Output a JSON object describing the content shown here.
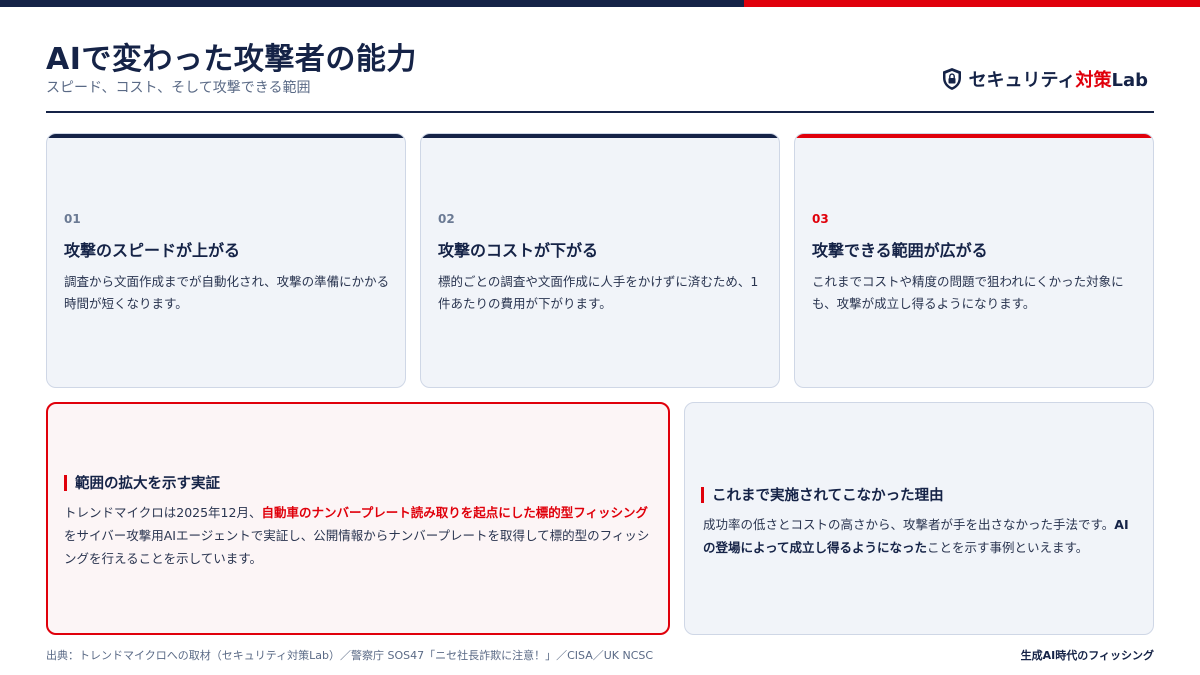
{
  "header": {
    "title": "AIで変わった攻撃者の能力",
    "subtitle": "スピード、コスト、そして攻撃できる範囲"
  },
  "brand": {
    "name_main": "セキュリティ",
    "name_accent": "対策",
    "name_suffix": "Lab",
    "icon": "shield-lock-icon"
  },
  "cards": [
    {
      "num": "01",
      "title": "攻撃のスピードが上がる",
      "body": "調査から文面作成までが自動化され、攻撃の準備にかかる時間が短くなります。"
    },
    {
      "num": "02",
      "title": "攻撃のコストが下がる",
      "body": "標的ごとの調査や文面作成に人手をかけずに済むため、1件あたりの費用が下がります。"
    },
    {
      "num": "03",
      "title": "攻撃できる範囲が広がる",
      "body": "これまでコストや精度の問題で狙われにくかった対象にも、攻撃が成立し得るようになります。"
    }
  ],
  "evidence": {
    "title": "範囲の拡大を示す実証",
    "body_pre": "トレンドマイクロは2025年12月、",
    "body_highlight": "自動車のナンバープレート読み取りを起点にした標的型フィッシング",
    "body_post": "をサイバー攻撃用AIエージェントで実証し、公開情報からナンバープレートを取得して標的型のフィッシングを行えることを示しています。"
  },
  "reason": {
    "title": "これまで実施されてこなかった理由",
    "body_pre": "成功率の低さとコストの高さから、攻撃者が手を出さなかった手法です。",
    "body_highlight": "AIの登場によって成立し得るようになった",
    "body_post": "ことを示す事例といえます。"
  },
  "footer": {
    "source": "出典：トレンドマイクロへの取材（セキュリティ対策Lab）／警察庁 SOS47「ニセ社長詐欺に注意！」／CISA／UK NCSC",
    "tag": "生成AI時代のフィッシング"
  },
  "colors": {
    "navy": "#152347",
    "red": "#e0000b",
    "card_bg": "#f1f4f9",
    "panel_red_bg": "#fcf5f6"
  }
}
